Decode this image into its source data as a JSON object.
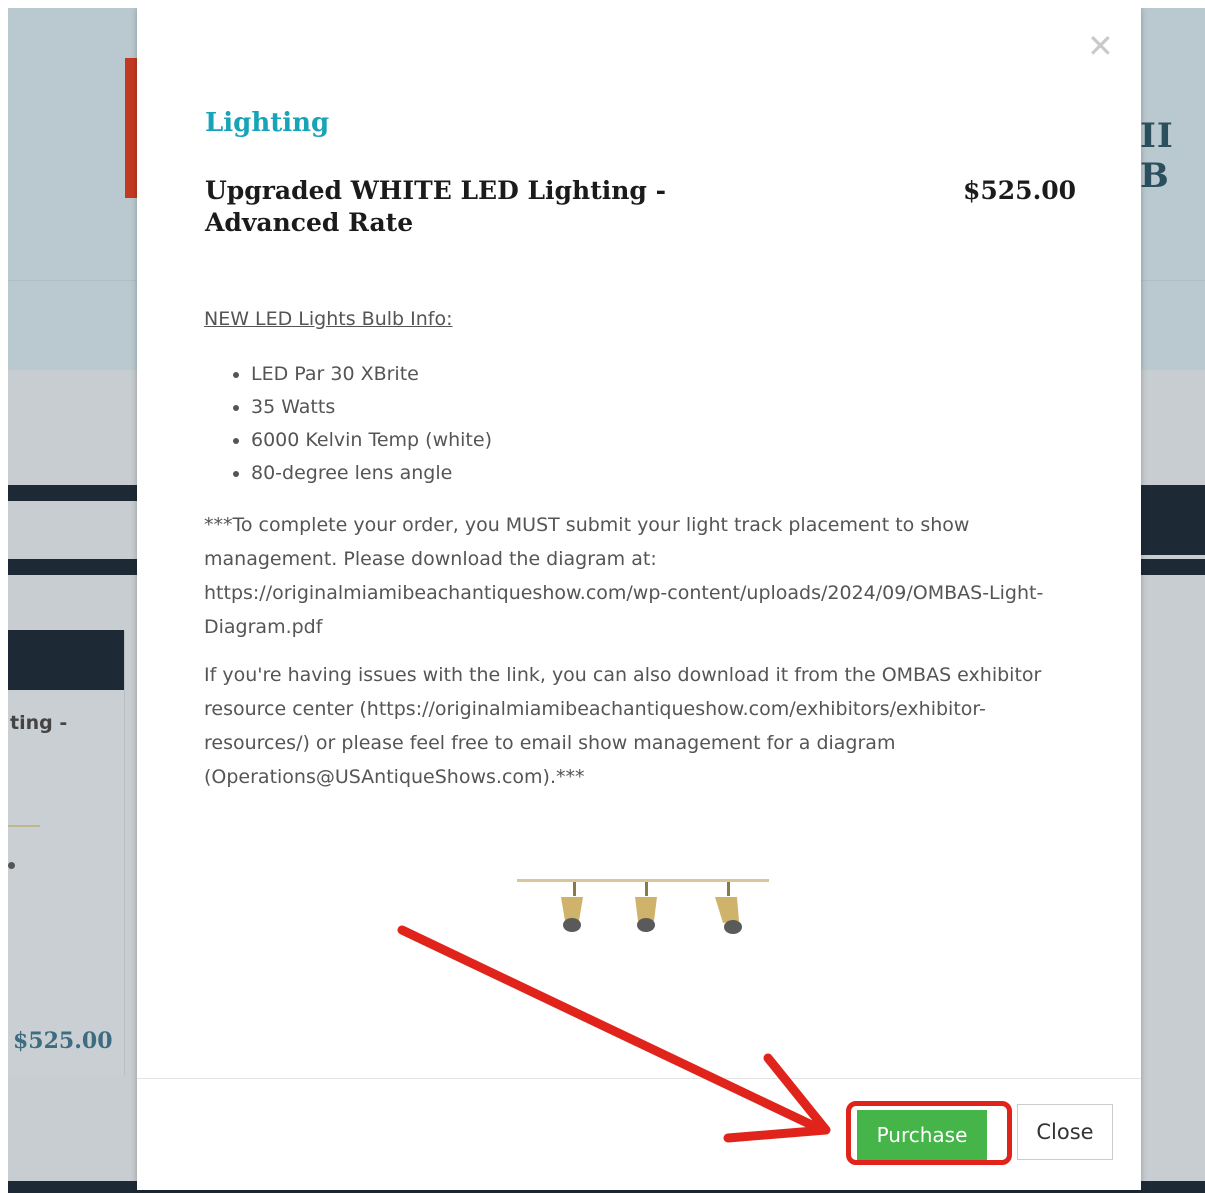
{
  "background": {
    "brand_fragment": "II B",
    "card_title_fragment": "ting -",
    "card_price": "$525.00"
  },
  "modal": {
    "close_icon": "close-icon",
    "category": "Lighting",
    "product_title": "Upgraded WHITE LED Lighting - Advanced Rate",
    "price": "$525.00",
    "subhead": "NEW LED Lights Bulb Info:",
    "bullets": [
      "LED Par 30 XBrite",
      "35 Watts",
      "6000 Kelvin Temp (white)",
      "80-degree lens angle"
    ],
    "paragraph1": "***To complete your order, you MUST submit your light track placement to show management. Please download the diagram at: https://originalmiamibeachantiqueshow.com/wp-content/uploads/2024/09/OMBAS-Light-Diagram.pdf",
    "paragraph2": "If you're having issues with the link, you can also download it from the OMBAS exhibitor resource center (https://originalmiamibeachantiqueshow.com/exhibitors/exhibitor-resources/) or please feel free to email show management for a diagram (Operations@USAntiqueShows.com).***",
    "purchase_label": "Purchase",
    "close_label": "Close"
  },
  "colors": {
    "accent": "#17a3b8",
    "purchase_green": "#45b549",
    "annotation_red": "#e0241b"
  }
}
